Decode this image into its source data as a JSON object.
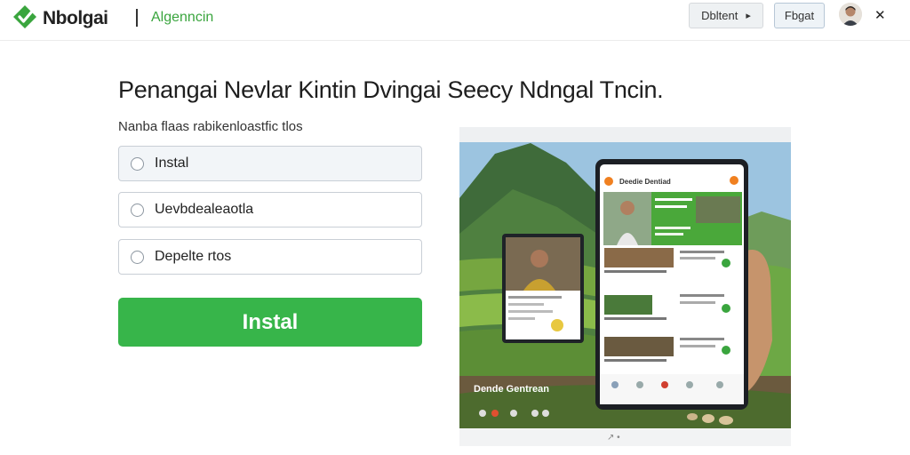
{
  "header": {
    "brand": "Nbolgai",
    "subtitle": "Algenncin",
    "button1_label": "Dbltent",
    "button1_icon": "chevron-right-icon",
    "button2_label": "Fbgat",
    "avatar_icon": "user-avatar",
    "close_icon": "close-icon",
    "logo_color": "#3aa53e"
  },
  "main": {
    "title": "Penangai Nevlar Kintin Dvingai Seecy Ndngal Tncin.",
    "subtitle": "Nanba flaas rabikenloastfic tlos",
    "options": [
      {
        "label": "Instal",
        "selected": true
      },
      {
        "label": "Uevbdealeaotla",
        "selected": false
      },
      {
        "label": "Depelte rtos",
        "selected": false
      }
    ],
    "install_button": "Instal",
    "accent_color": "#37b54a"
  },
  "promo": {
    "app_title": "Deedie Dentiad",
    "caption": "Dende Gentrean"
  }
}
